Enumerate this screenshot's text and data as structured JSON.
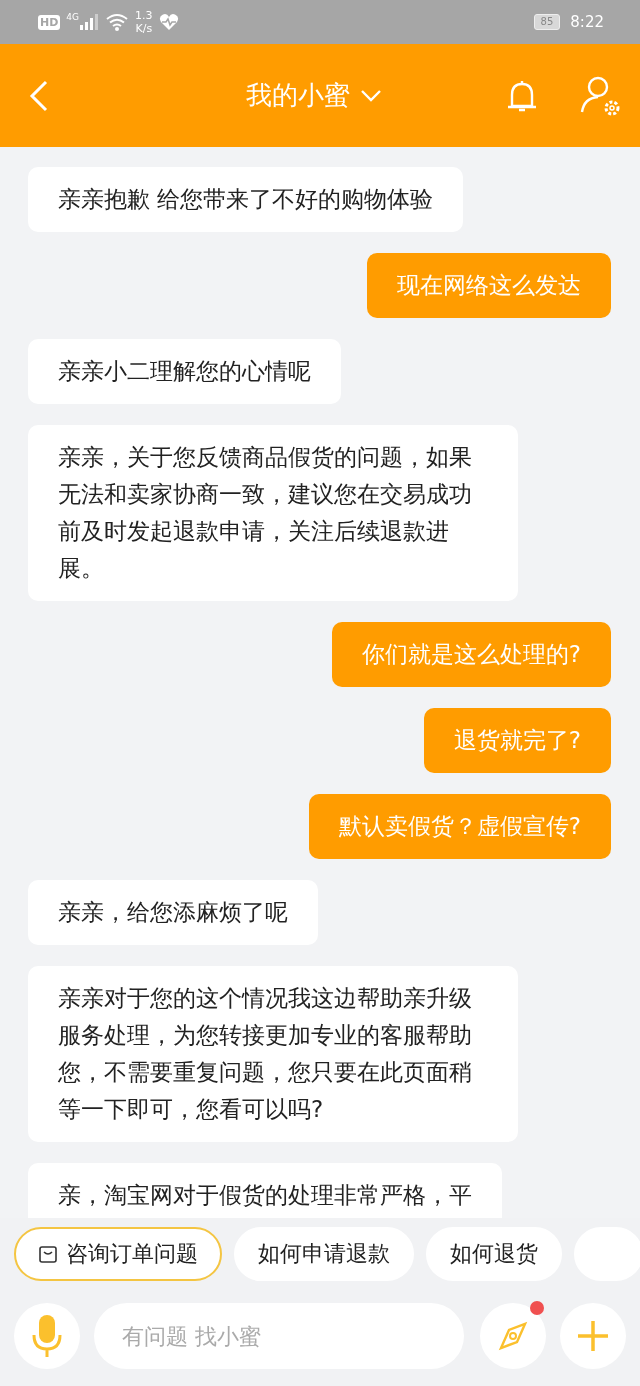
{
  "status_bar": {
    "hd": "HD",
    "network": "4G",
    "speed_value": "1.3",
    "speed_unit": "K/s",
    "battery": "85",
    "time": "8:22"
  },
  "header": {
    "title": "我的小蜜"
  },
  "messages": [
    {
      "kind": "agent",
      "text": "亲亲抱歉 给您带来了不好的购物体验"
    },
    {
      "kind": "user",
      "text": "现在网络这么发达"
    },
    {
      "kind": "agent",
      "text": "亲亲小二理解您的心情呢"
    },
    {
      "kind": "agent",
      "text": "亲亲，关于您反馈商品假货的问题，如果无法和卖家协商一致，建议您在交易成功前及时发起退款申请，关注后续退款进展。"
    },
    {
      "kind": "user",
      "text": "你们就是这么处理的?"
    },
    {
      "kind": "user",
      "text": "退货就完了?"
    },
    {
      "kind": "user",
      "text": "默认卖假货？虚假宣传?"
    },
    {
      "kind": "agent",
      "text": "亲亲，给您添麻烦了呢"
    },
    {
      "kind": "agent",
      "text": "亲亲对于您的这个情况我这边帮助亲升级服务处理，为您转接更加专业的客服帮助您，不需要重复问题，您只要在此页面稍等一下即可，您看可以吗?"
    },
    {
      "kind": "agent",
      "text": "亲，淘宝网对于假货的处理非常严格，平"
    }
  ],
  "quick_replies": [
    {
      "label": "咨询订单问题",
      "selected": true
    },
    {
      "label": "如何申请退款",
      "selected": false
    },
    {
      "label": "如何退货",
      "selected": false
    },
    {
      "selected": false
    }
  ],
  "input": {
    "placeholder": "有问题 找小蜜"
  },
  "explore_badge": true
}
